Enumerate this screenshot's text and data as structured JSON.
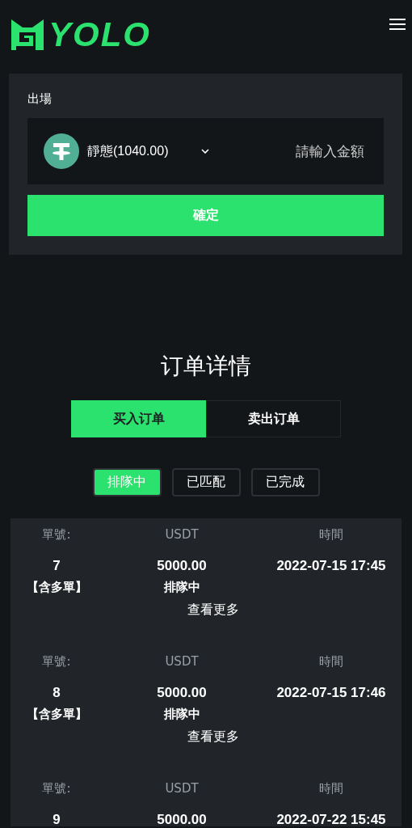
{
  "header": {
    "logo_text": "YOLO"
  },
  "withdraw": {
    "label": "出場",
    "asset": "靜態(1040.00)",
    "amount_placeholder": "請輸入金額",
    "confirm": "確定"
  },
  "orders": {
    "title": "订单详情",
    "tabs": [
      {
        "label": "买入订单",
        "selected": true
      },
      {
        "label": "卖出订单",
        "selected": false
      }
    ],
    "filters": [
      {
        "label": "排隊中",
        "selected": true
      },
      {
        "label": "已匹配",
        "selected": false
      },
      {
        "label": "已完成",
        "selected": false
      }
    ],
    "items": [
      {
        "no_label": "單號:",
        "usdt_label": "USDT",
        "time_label": "時間",
        "no": "7",
        "usdt": "5000.00",
        "time": "2022-07-15 17:45",
        "tag": "【含多單】",
        "status": "排隊中",
        "more": "查看更多"
      },
      {
        "no_label": "單號:",
        "usdt_label": "USDT",
        "time_label": "時間",
        "no": "8",
        "usdt": "5000.00",
        "time": "2022-07-15 17:46",
        "tag": "【含多單】",
        "status": "排隊中",
        "more": "查看更多"
      },
      {
        "no_label": "單號:",
        "usdt_label": "USDT",
        "time_label": "時間",
        "no": "9",
        "usdt": "5000.00",
        "time": "2022-07-22 15:45"
      }
    ]
  }
}
